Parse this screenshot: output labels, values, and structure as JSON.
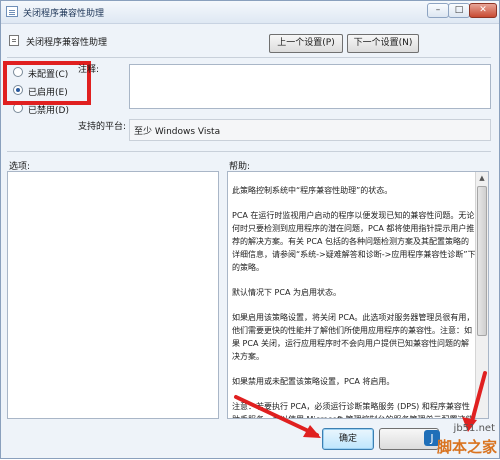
{
  "window": {
    "title": "关闭程序兼容性助理",
    "buttons": {
      "minimize": "–",
      "maximize": "□",
      "close": "✕"
    }
  },
  "header": {
    "policy_title": "关闭程序兼容性助理",
    "prev_label": "上一个设置(P)",
    "next_label": "下一个设置(N)"
  },
  "state": {
    "not_configured": "未配置(C)",
    "enabled": "已启用(E)",
    "disabled": "已禁用(D)",
    "selected": "enabled"
  },
  "comment": {
    "label": "注释:",
    "value": ""
  },
  "platform": {
    "label": "支持的平台:",
    "value": "至少 Windows Vista"
  },
  "options": {
    "label": "选项:"
  },
  "help": {
    "label": "帮助:",
    "paragraphs": [
      "此策略控制系统中“程序兼容性助理”的状态。",
      "PCA 在运行时监视用户启动的程序以便发现已知的兼容性问题。无论何时只要检测到应用程序的潜在问题，PCA 都将使用指针提示用户推荐的解决方案。有关 PCA 包括的各种问题检测方案及其配置策略的详细信息，请参阅“系统->疑难解答和诊断->应用程序兼容性诊断”下的策略。",
      "默认情况下 PCA 为启用状态。",
      "如果启用该策略设置，将关闭 PCA。此选项对服务器管理员很有用，他们需要更快的性能并了解他们所使用应用程序的兼容性。注意：如果 PCA 关闭，运行应用程序时不会向用户提供已知兼容性问题的解决方案。",
      "如果禁用或未配置该策略设置，PCA 将启用。",
      "注意：若要执行 PCA，必须运行诊断策略服务 (DPS) 和程序兼容性助手服务。可以使用 Microsoft 管理控制台的服务管理单元配置这些服务。"
    ]
  },
  "footer": {
    "ok_label": "确定"
  },
  "watermark": {
    "url": "jb51.net",
    "text": "脚本之家"
  },
  "colors": {
    "annotation": "#e02020",
    "accent": "#3c7fb1"
  }
}
